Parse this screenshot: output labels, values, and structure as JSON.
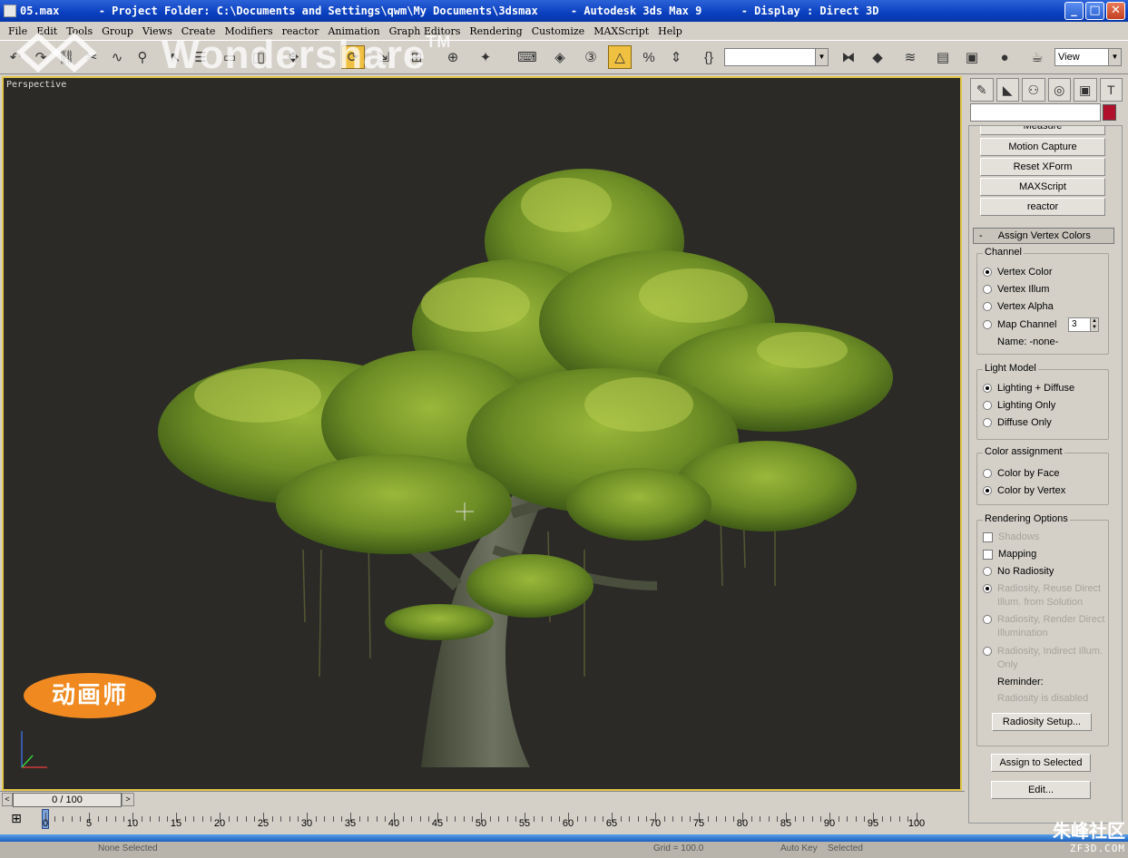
{
  "window": {
    "title": "05.max      - Project Folder: C:\\Documents and Settings\\qwm\\My Documents\\3dsmax     - Autodesk 3ds Max 9      - Display : Direct 3D",
    "buttons": {
      "minimize": "_",
      "maximize": "□",
      "close": "✕"
    }
  },
  "menu": [
    "File",
    "Edit",
    "Tools",
    "Group",
    "Views",
    "Create",
    "Modifiers",
    "reactor",
    "Animation",
    "Graph Editors",
    "Rendering",
    "Customize",
    "MAXScript",
    "Help"
  ],
  "toolbar": {
    "watermark": "Wondershare",
    "watermark_tm": "TM",
    "view_select": "View"
  },
  "viewport": {
    "label": "Perspective",
    "badge_text": "动画师"
  },
  "command_panel": {
    "tab_icons": [
      "create-icon",
      "modify-icon",
      "hierarchy-icon",
      "motion-icon",
      "display-icon",
      "utilities-icon"
    ],
    "name_value": "",
    "object_color": "#b0102c",
    "utility_buttons": [
      "Measure",
      "Motion Capture",
      "Reset XForm",
      "MAXScript",
      "reactor"
    ],
    "rollout_title": "Assign Vertex Colors",
    "rollout_toggle": "-",
    "channel": {
      "title": "Channel",
      "options": [
        "Vertex Color",
        "Vertex Illum",
        "Vertex Alpha",
        "Map Channel"
      ],
      "selected": "Vertex Color",
      "map_channel_value": "3",
      "name_label": "Name: -none-"
    },
    "light_model": {
      "title": "Light Model",
      "options": [
        "Lighting + Diffuse",
        "Lighting Only",
        "Diffuse Only"
      ],
      "selected": "Lighting + Diffuse"
    },
    "color_assignment": {
      "title": "Color assignment",
      "options": [
        "Color by Face",
        "Color by Vertex"
      ],
      "selected": "Color by Vertex"
    },
    "rendering_options": {
      "title": "Rendering Options",
      "shadows": "Shadows",
      "mapping": "Mapping",
      "no_radiosity": "No Radiosity",
      "radiosity_reuse_1": "Radiosity, Reuse Direct",
      "radiosity_reuse_2": "Illum. from Solution",
      "radiosity_render_1": "Radiosity, Render Direct",
      "radiosity_render_2": "Illumination",
      "radiosity_indirect_1": "Radiosity, Indirect Illum.",
      "radiosity_indirect_2": "Only",
      "reminder_label": "Reminder:",
      "reminder_text": "Radiosity is disabled",
      "radiosity_setup": "Radiosity Setup..."
    },
    "assign_to_selected": "Assign to Selected",
    "edit": "Edit..."
  },
  "time_slider": {
    "current": "0 / 100",
    "left_arrow": "<",
    "right_arrow": ">"
  },
  "trackbar": {
    "ticks": [
      "0",
      "5",
      "10",
      "15",
      "20",
      "25",
      "30",
      "35",
      "40",
      "45",
      "50",
      "55",
      "60",
      "65",
      "70",
      "75",
      "80",
      "85",
      "90",
      "95",
      "100"
    ]
  },
  "status": {
    "selection": "None Selected",
    "auto_key": "Auto Key",
    "selected": "Selected",
    "grid": "Grid = 100.0"
  },
  "corner_logo": {
    "cn": "朱峰社区",
    "en": "ZF3D.COM"
  }
}
